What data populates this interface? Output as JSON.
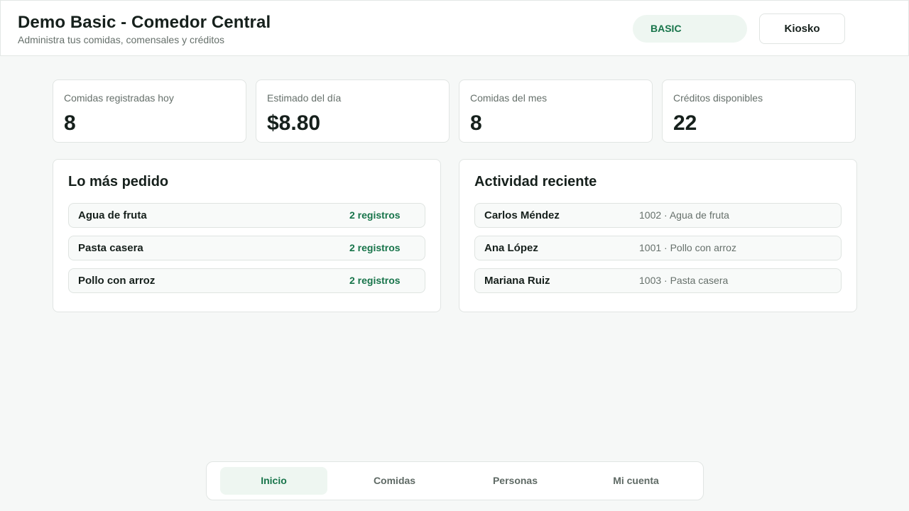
{
  "header": {
    "title": "Demo Basic - Comedor Central",
    "subtitle": "Administra tus comidas, comensales y créditos",
    "plan_badge": "BASIC",
    "kiosk_button": "Kiosko"
  },
  "stats": [
    {
      "label": "Comidas registradas hoy",
      "value": "8"
    },
    {
      "label": "Estimado del día",
      "value": "$8.80"
    },
    {
      "label": "Comidas del mes",
      "value": "8"
    },
    {
      "label": "Créditos disponibles",
      "value": "22"
    }
  ],
  "top_ordered": {
    "title": "Lo más pedido",
    "items": [
      {
        "name": "Agua de fruta",
        "count": "2 registros"
      },
      {
        "name": "Pasta casera",
        "count": "2 registros"
      },
      {
        "name": "Pollo con arroz",
        "count": "2 registros"
      }
    ]
  },
  "recent_activity": {
    "title": "Actividad reciente",
    "items": [
      {
        "name": "Carlos Méndez",
        "detail": "1002 · Agua de fruta"
      },
      {
        "name": "Ana López",
        "detail": "1001 · Pollo con arroz"
      },
      {
        "name": "Mariana Ruiz",
        "detail": "1003 · Pasta casera"
      }
    ]
  },
  "nav": {
    "tabs": [
      {
        "label": "Inicio",
        "active": true
      },
      {
        "label": "Comidas",
        "active": false
      },
      {
        "label": "Personas",
        "active": false
      },
      {
        "label": "Mi cuenta",
        "active": false
      }
    ]
  },
  "colors": {
    "accent": "#17744a",
    "accent_bg": "#eef6f1",
    "page_bg": "#f6f8f7"
  }
}
